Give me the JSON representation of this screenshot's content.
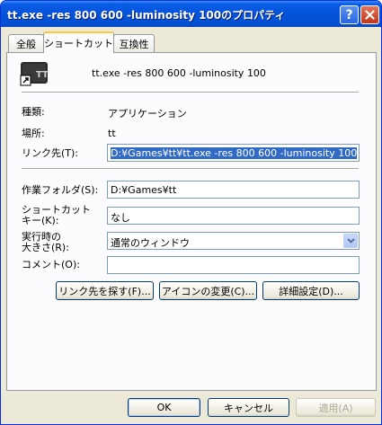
{
  "window": {
    "title": "tt.exe -res 800 600 -luminosity 100のプロパティ",
    "help_glyph": "?",
    "close_glyph": "✕"
  },
  "tabs": [
    {
      "label": "全般"
    },
    {
      "label": "ショートカット"
    },
    {
      "label": "互換性"
    }
  ],
  "shortcut": {
    "name": "tt.exe -res 800 600 -luminosity 100",
    "type_label": "種類:",
    "type_value": "アプリケーション",
    "location_label": "場所:",
    "location_value": "tt",
    "target_label": "リンク先(T):",
    "target_value": "D:¥Games¥tt¥tt.exe -res 800 600 -luminosity 100",
    "workdir_label": "作業フォルダ(S):",
    "workdir_value": "D:¥Games¥tt",
    "hotkey_label_1": "ショートカット",
    "hotkey_label_2": "キー(K):",
    "hotkey_value": "なし",
    "run_label_1": "実行時の",
    "run_label_2": "大きさ(R):",
    "run_value": "通常のウィンドウ",
    "comment_label": "コメント(O):",
    "comment_value": "",
    "find_target_button": "リンク先を探す(F)...",
    "change_icon_button": "アイコンの変更(C)...",
    "advanced_button": "詳細設定(D)..."
  },
  "footer": {
    "ok": "OK",
    "cancel": "キャンセル",
    "apply": "適用(A)"
  },
  "colors": {
    "titlebar": "#0453d9",
    "selection": "#316ac5",
    "face": "#ece9d8"
  }
}
